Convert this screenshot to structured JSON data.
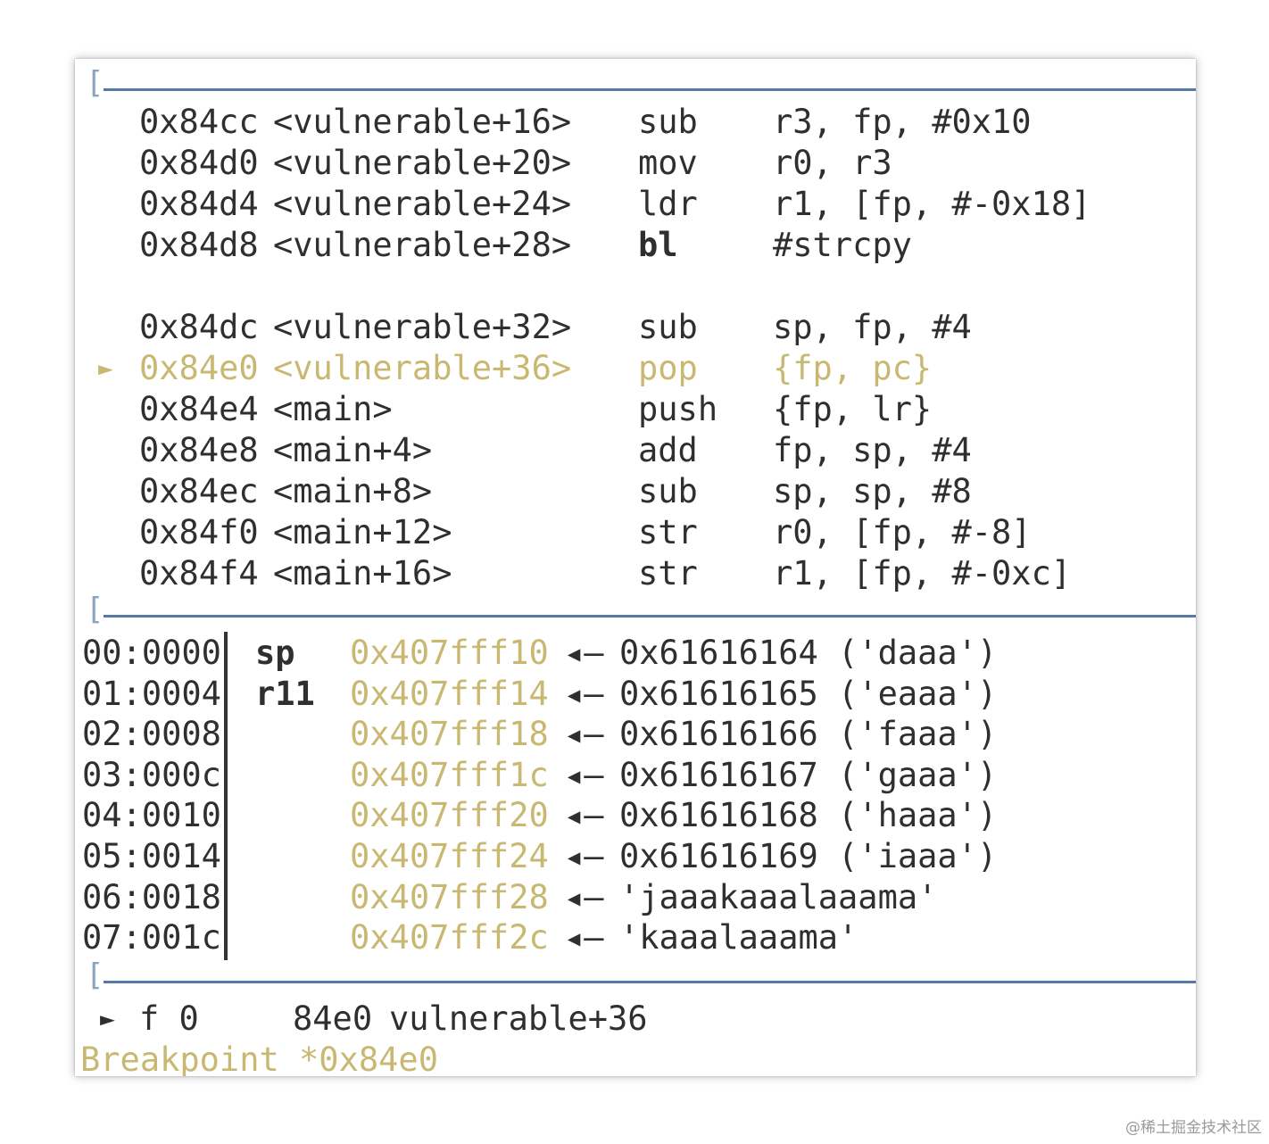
{
  "separator_bracket": "[",
  "disasm": [
    {
      "marker": "",
      "addr": "0x84cc",
      "sym": "<vulnerable+16>",
      "mnem": "sub",
      "ops": "r3, fp, #0x10"
    },
    {
      "marker": "",
      "addr": "0x84d0",
      "sym": "<vulnerable+20>",
      "mnem": "mov",
      "ops": "r0, r3"
    },
    {
      "marker": "",
      "addr": "0x84d4",
      "sym": "<vulnerable+24>",
      "mnem": "ldr",
      "ops": "r1, [fp, #-0x18]"
    },
    {
      "marker": "",
      "addr": "0x84d8",
      "sym": "<vulnerable+28>",
      "mnem": "bl",
      "ops": "#strcpy"
    },
    {
      "marker": "",
      "addr": "0x84dc",
      "sym": "<vulnerable+32>",
      "mnem": "sub",
      "ops": "sp, fp, #4"
    },
    {
      "marker": "►",
      "addr": "0x84e0",
      "sym": "<vulnerable+36>",
      "mnem": "pop",
      "ops": "{fp, pc}"
    },
    {
      "marker": "",
      "addr": "0x84e4",
      "sym": "<main>",
      "mnem": "push",
      "ops": "{fp, lr}"
    },
    {
      "marker": "",
      "addr": "0x84e8",
      "sym": "<main+4>",
      "mnem": "add",
      "ops": "fp, sp, #4"
    },
    {
      "marker": "",
      "addr": "0x84ec",
      "sym": "<main+8>",
      "mnem": "sub",
      "ops": "sp, sp, #8"
    },
    {
      "marker": "",
      "addr": "0x84f0",
      "sym": "<main+12>",
      "mnem": "str",
      "ops": "r0, [fp, #-8]"
    },
    {
      "marker": "",
      "addr": "0x84f4",
      "sym": "<main+16>",
      "mnem": "str",
      "ops": "r1, [fp, #-0xc]"
    }
  ],
  "stack": [
    {
      "offset": "00:0000",
      "reg": "sp",
      "addr": "0x407fff10",
      "arrow": "◂—",
      "value": "0x61616164 ('daaa')"
    },
    {
      "offset": "01:0004",
      "reg": "r11",
      "addr": "0x407fff14",
      "arrow": "◂—",
      "value": "0x61616165 ('eaaa')"
    },
    {
      "offset": "02:0008",
      "reg": "",
      "addr": "0x407fff18",
      "arrow": "◂—",
      "value": "0x61616166 ('faaa')"
    },
    {
      "offset": "03:000c",
      "reg": "",
      "addr": "0x407fff1c",
      "arrow": "◂—",
      "value": "0x61616167 ('gaaa')"
    },
    {
      "offset": "04:0010",
      "reg": "",
      "addr": "0x407fff20",
      "arrow": "◂—",
      "value": "0x61616168 ('haaa')"
    },
    {
      "offset": "05:0014",
      "reg": "",
      "addr": "0x407fff24",
      "arrow": "◂—",
      "value": "0x61616169 ('iaaa')"
    },
    {
      "offset": "06:0018",
      "reg": "",
      "addr": "0x407fff28",
      "arrow": "◂—",
      "value": "'jaaakaaalaaama'"
    },
    {
      "offset": "07:001c",
      "reg": "",
      "addr": "0x407fff2c",
      "arrow": "◂—",
      "value": "'kaaalaaama'"
    }
  ],
  "backtrace": {
    "marker": "►",
    "frame": "f 0",
    "addr": "84e0",
    "sym": "vulnerable+36"
  },
  "breakpoint": "Breakpoint *0x84e0",
  "watermark": "@稀土掘金技术社区",
  "colors": {
    "highlight": "#c8b872",
    "separator": "#5579a6",
    "text": "#2f2f2f"
  }
}
